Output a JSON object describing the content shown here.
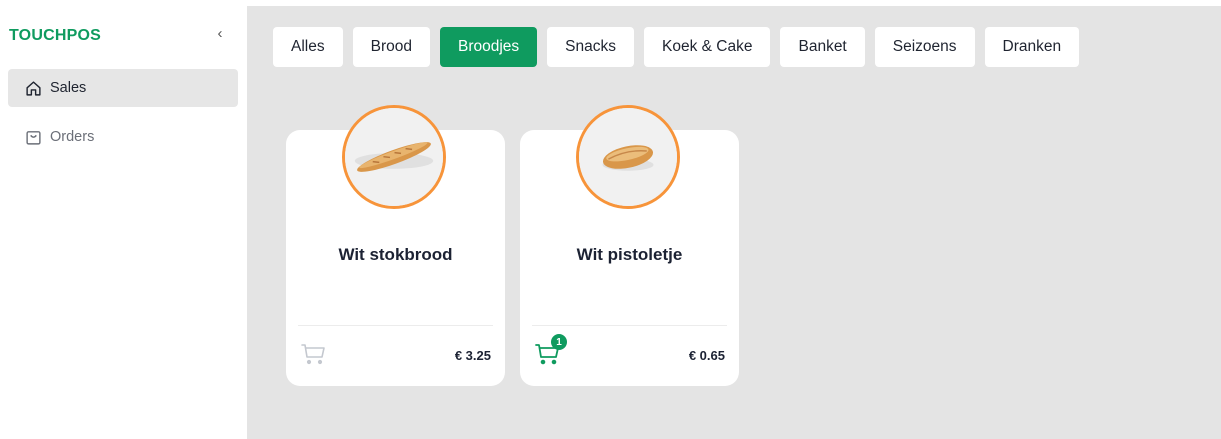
{
  "brand": "TOUCHPOS",
  "collapse_icon": "chevron-left-icon",
  "nav": [
    {
      "label": "Sales",
      "icon": "home-icon",
      "active": true
    },
    {
      "label": "Orders",
      "icon": "shopping-bag-icon",
      "active": false
    }
  ],
  "tabs": [
    {
      "label": "Alles",
      "selected": false
    },
    {
      "label": "Brood",
      "selected": false
    },
    {
      "label": "Broodjes",
      "selected": true
    },
    {
      "label": "Snacks",
      "selected": false
    },
    {
      "label": "Koek & Cake",
      "selected": false
    },
    {
      "label": "Banket",
      "selected": false
    },
    {
      "label": "Seizoens",
      "selected": false
    },
    {
      "label": "Dranken",
      "selected": false
    }
  ],
  "products": [
    {
      "name": "Wit stokbrood",
      "price": "€ 3.25",
      "in_cart": 0
    },
    {
      "name": "Wit pistoletje",
      "price": "€ 0.65",
      "in_cart": "1"
    }
  ],
  "colors": {
    "accent": "#0f9b5f",
    "photo_ring": "#f7943a",
    "background": "#e4e4e4"
  }
}
